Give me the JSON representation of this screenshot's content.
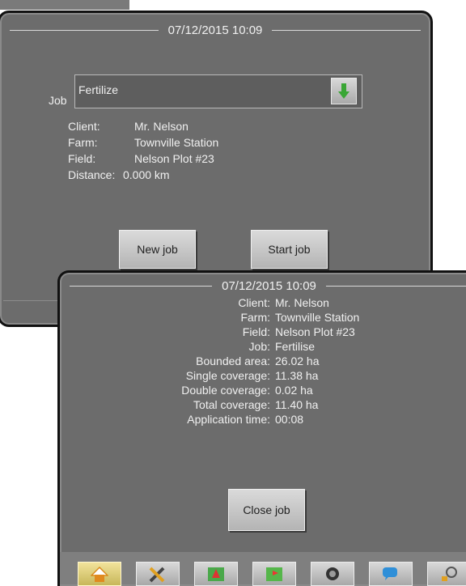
{
  "setup_screen": {
    "datetime": "07/12/2015 10:09",
    "job_label": "Job",
    "job_value": "Fertilize",
    "details": [
      {
        "key": "Client:",
        "value": "Mr. Nelson"
      },
      {
        "key": "Farm:",
        "value": "Townville Station"
      },
      {
        "key": "Field:",
        "value": "Nelson Plot #23"
      },
      {
        "key": "Distance:",
        "value": "0.000 km"
      }
    ],
    "new_job_label": "New job",
    "start_job_label": "Start job"
  },
  "summary_screen": {
    "datetime": "07/12/2015 10:09",
    "details": [
      {
        "key": "Client:",
        "value": "Mr. Nelson"
      },
      {
        "key": "Farm:",
        "value": "Townville Station"
      },
      {
        "key": "Field:",
        "value": "Nelson Plot #23"
      },
      {
        "key": "Job:",
        "value": "Fertilise"
      },
      {
        "key": "Bounded area:",
        "value": "26.02 ha"
      },
      {
        "key": "Single coverage:",
        "value": "11.38 ha"
      },
      {
        "key": "Double coverage:",
        "value": "0.02 ha"
      },
      {
        "key": "Total coverage:",
        "value": "11.40 ha"
      },
      {
        "key": "Application time:",
        "value": "00:08"
      }
    ],
    "close_job_label": "Close job"
  },
  "toolbar": {
    "items": [
      {
        "icon": "home-icon",
        "active": true
      },
      {
        "icon": "tools-icon",
        "active": false
      },
      {
        "icon": "map-icon",
        "active": false
      },
      {
        "icon": "field-map-icon",
        "active": false
      },
      {
        "icon": "camera-icon",
        "active": false
      },
      {
        "icon": "chat-icon",
        "active": false
      },
      {
        "icon": "unit-info-icon",
        "active": false
      }
    ]
  },
  "colors": {
    "screen_bg": "#6c6c6c",
    "accent_green": "#3aa635",
    "active_tab": "#e6d47a"
  }
}
